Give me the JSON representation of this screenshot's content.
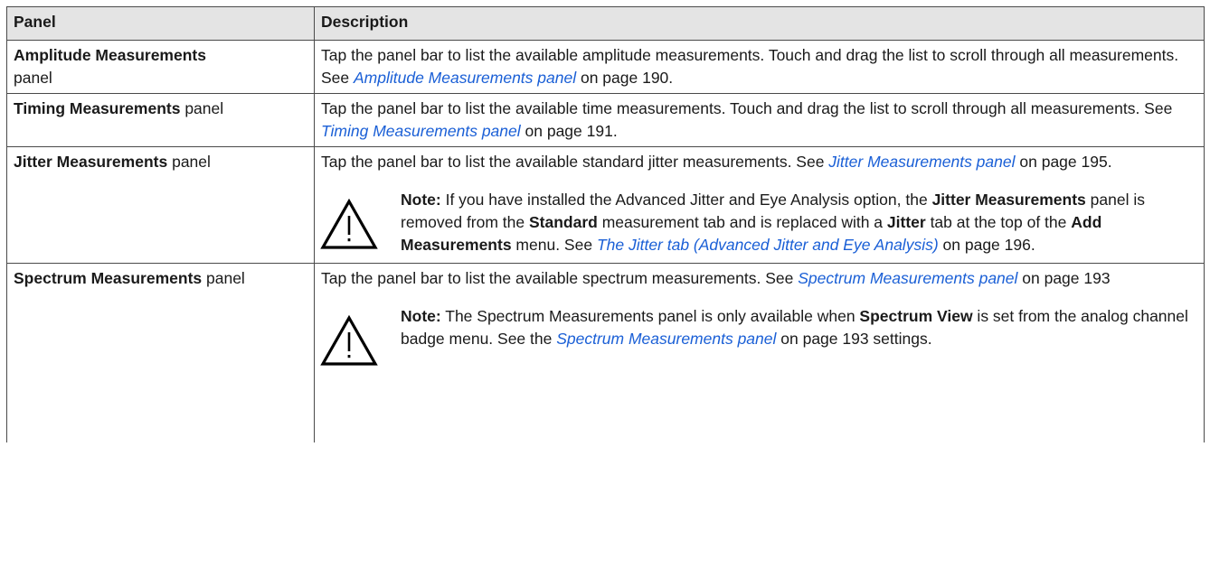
{
  "table": {
    "headers": [
      "Panel",
      "Description"
    ],
    "rows": [
      {
        "panel_bold": "Amplitude Measurements",
        "panel_suffix": "panel",
        "desc": "Tap the panel bar to list the available amplitude measurements. Touch and drag the list to scroll through all measurements. See ",
        "link": "Amplitude Measurements panel",
        "after_link": " on page 190."
      },
      {
        "panel_bold": "Timing Measurements",
        "panel_suffix": " panel",
        "desc": "Tap the panel bar to list the available time measurements. Touch and drag the list to scroll through all measurements. See ",
        "link": "Timing Measurements panel",
        "after_link": " on page 191."
      },
      {
        "panel_bold": "Jitter Measurements",
        "panel_suffix": " panel",
        "desc": "Tap the panel bar to list the available standard jitter measurements. See ",
        "link": "Jitter Measurements panel",
        "after_link": " on page 195.",
        "note": {
          "label": "Note:",
          "t1": " If you have installed the Advanced Jitter and Eye Analysis option, the ",
          "b1": "Jitter Measurements",
          "t2": " panel is removed from the ",
          "b2": "Standard",
          "t3": " measurement tab and is replaced with a ",
          "b3": "Jitter",
          "t4": " tab at the top of the ",
          "b4": "Add Measurements",
          "t5": " menu. See ",
          "link": "The Jitter tab (Advanced Jitter and Eye Analysis)",
          "t6": " on page 196."
        }
      },
      {
        "panel_bold": "Spectrum Measurements",
        "panel_suffix": " panel",
        "desc": "Tap the panel bar to list the available spectrum measurements. See ",
        "link": "Spectrum Measurements panel",
        "after_link": " on page 193",
        "note": {
          "label": "Note:",
          "t1": " The Spectrum Measurements panel is only available when ",
          "b1": "Spectrum View",
          "t2": " is set from the analog channel badge menu. See the ",
          "link": "Spectrum Measurements panel",
          "t3": " on page 193 settings."
        }
      }
    ]
  },
  "icons": {
    "warning": "warning-triangle-icon"
  }
}
